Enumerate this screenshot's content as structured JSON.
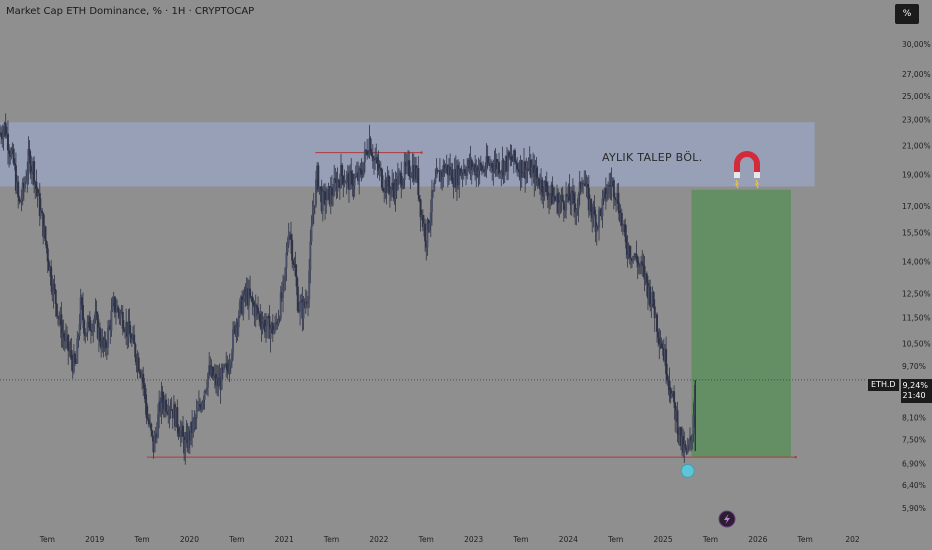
{
  "header": {
    "title": "Market Cap ETH Dominance, % · 1H · CRYPTOCAP",
    "percent_button": "%"
  },
  "annotations": {
    "zone_label": "AYLIK TALEP BÖL.",
    "symbol_tag": "ETH.D",
    "current_price": "9,24%",
    "countdown": "21:40"
  },
  "colors": {
    "background": "#8f8f8f",
    "candle": "#2f3346",
    "demand_zone": "#9aa6c4",
    "target_zone": "#5f8f61",
    "level_line": "#b03a3a",
    "marker": "#5ec4d8"
  },
  "icons": {
    "magnet": "magnet-icon",
    "flash": "flash-icon"
  },
  "chart_data": {
    "type": "line",
    "y_scale": "log",
    "ylim": [
      5.5,
      31.5
    ],
    "y_ticks": [
      "30,00%",
      "27,00%",
      "25,00%",
      "23,00%",
      "21,00%",
      "19,00%",
      "17,00%",
      "15,50%",
      "14,00%",
      "12,50%",
      "11,50%",
      "10,50%",
      "9,70%",
      "8,10%",
      "7,50%",
      "6,90%",
      "6,40%",
      "5,90%"
    ],
    "x_range": [
      2018.0,
      2027.1
    ],
    "x_ticks": [
      {
        "label": "Tem",
        "t": 2018.5
      },
      {
        "label": "2019",
        "t": 2019.0
      },
      {
        "label": "Tem",
        "t": 2019.5
      },
      {
        "label": "2020",
        "t": 2020.0
      },
      {
        "label": "Tem",
        "t": 2020.5
      },
      {
        "label": "2021",
        "t": 2021.0
      },
      {
        "label": "Tem",
        "t": 2021.5
      },
      {
        "label": "2022",
        "t": 2022.0
      },
      {
        "label": "Tem",
        "t": 2022.5
      },
      {
        "label": "2023",
        "t": 2023.0
      },
      {
        "label": "Tem",
        "t": 2023.5
      },
      {
        "label": "2024",
        "t": 2024.0
      },
      {
        "label": "Tem",
        "t": 2024.5
      },
      {
        "label": "2025",
        "t": 2025.0
      },
      {
        "label": "Tem",
        "t": 2025.5
      },
      {
        "label": "2026",
        "t": 2026.0
      },
      {
        "label": "Tem",
        "t": 2026.5
      },
      {
        "label": "202",
        "t": 2027.0
      }
    ],
    "series": [
      {
        "values": [
          [
            2018.0,
            22.0
          ],
          [
            2018.05,
            22.5
          ],
          [
            2018.15,
            19.5
          ],
          [
            2018.2,
            17.0
          ],
          [
            2018.25,
            18.0
          ],
          [
            2018.3,
            20.0
          ],
          [
            2018.35,
            19.5
          ],
          [
            2018.4,
            17.5
          ],
          [
            2018.45,
            16.0
          ],
          [
            2018.55,
            13.0
          ],
          [
            2018.65,
            11.0
          ],
          [
            2018.75,
            10.0
          ],
          [
            2018.8,
            9.6
          ],
          [
            2018.85,
            12.0
          ],
          [
            2018.9,
            11.0
          ],
          [
            2019.0,
            11.5
          ],
          [
            2019.1,
            10.2
          ],
          [
            2019.2,
            12.0
          ],
          [
            2019.3,
            11.5
          ],
          [
            2019.4,
            10.5
          ],
          [
            2019.5,
            9.5
          ],
          [
            2019.55,
            8.2
          ],
          [
            2019.62,
            7.3
          ],
          [
            2019.7,
            8.6
          ],
          [
            2019.8,
            8.5
          ],
          [
            2019.9,
            7.8
          ],
          [
            2019.95,
            7.3
          ],
          [
            2020.0,
            7.6
          ],
          [
            2020.1,
            8.3
          ],
          [
            2020.2,
            9.5
          ],
          [
            2020.3,
            9.1
          ],
          [
            2020.4,
            9.6
          ],
          [
            2020.5,
            11.5
          ],
          [
            2020.6,
            12.5
          ],
          [
            2020.7,
            11.8
          ],
          [
            2020.8,
            11.2
          ],
          [
            2020.9,
            11.0
          ],
          [
            2021.0,
            12.8
          ],
          [
            2021.05,
            16.0
          ],
          [
            2021.1,
            14.0
          ],
          [
            2021.15,
            12.0
          ],
          [
            2021.2,
            11.8
          ],
          [
            2021.25,
            12.6
          ],
          [
            2021.3,
            16.5
          ],
          [
            2021.35,
            19.0
          ],
          [
            2021.4,
            17.2
          ],
          [
            2021.5,
            17.8
          ],
          [
            2021.6,
            19.0
          ],
          [
            2021.7,
            18.5
          ],
          [
            2021.8,
            18.8
          ],
          [
            2021.9,
            21.5
          ],
          [
            2021.95,
            20.0
          ],
          [
            2022.05,
            18.5
          ],
          [
            2022.15,
            18.0
          ],
          [
            2022.25,
            19.0
          ],
          [
            2022.35,
            19.5
          ],
          [
            2022.4,
            19.0
          ],
          [
            2022.45,
            16.5
          ],
          [
            2022.5,
            15.2
          ],
          [
            2022.55,
            17.0
          ],
          [
            2022.6,
            18.5
          ],
          [
            2022.7,
            19.5
          ],
          [
            2022.8,
            18.8
          ],
          [
            2022.9,
            19.5
          ],
          [
            2023.0,
            19.5
          ],
          [
            2023.1,
            19.3
          ],
          [
            2023.2,
            19.8
          ],
          [
            2023.3,
            19.6
          ],
          [
            2023.4,
            20.0
          ],
          [
            2023.5,
            19.5
          ],
          [
            2023.6,
            19.3
          ],
          [
            2023.7,
            18.5
          ],
          [
            2023.8,
            17.8
          ],
          [
            2023.9,
            17.2
          ],
          [
            2024.0,
            17.5
          ],
          [
            2024.1,
            17.0
          ],
          [
            2024.15,
            19.2
          ],
          [
            2024.2,
            17.5
          ],
          [
            2024.3,
            16.0
          ],
          [
            2024.4,
            17.8
          ],
          [
            2024.45,
            18.5
          ],
          [
            2024.5,
            18.0
          ],
          [
            2024.55,
            16.5
          ],
          [
            2024.6,
            15.0
          ],
          [
            2024.7,
            14.2
          ],
          [
            2024.8,
            13.4
          ],
          [
            2024.85,
            12.6
          ],
          [
            2024.9,
            12.0
          ],
          [
            2024.95,
            11.0
          ],
          [
            2025.0,
            10.3
          ],
          [
            2025.05,
            9.5
          ],
          [
            2025.1,
            8.6
          ],
          [
            2025.15,
            8.0
          ],
          [
            2025.2,
            7.3
          ],
          [
            2025.25,
            7.1
          ],
          [
            2025.3,
            7.5
          ],
          [
            2025.34,
            9.24
          ]
        ]
      }
    ],
    "demand_zone": {
      "x_range": [
        2018.0,
        2026.6
      ],
      "y_range": [
        18.2,
        22.8
      ]
    },
    "target_zone": {
      "x_range": [
        2025.3,
        2026.35
      ],
      "y_range": [
        7.05,
        18.0
      ]
    },
    "level_lines": [
      {
        "x_range": [
          2019.55,
          2026.4
        ],
        "y": 7.05
      },
      {
        "x_range": [
          2021.33,
          2022.45
        ],
        "y": 20.5
      }
    ],
    "current_price_line": 9.24
  }
}
